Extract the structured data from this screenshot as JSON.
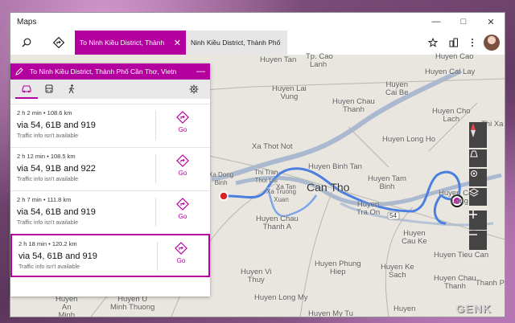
{
  "window": {
    "title": "Maps"
  },
  "tabs": [
    {
      "label": "To Ninh Kiều District, Thành",
      "active": true
    },
    {
      "label": "Ninh Kiều District, Thành Phố Cầr",
      "active": false
    }
  ],
  "panel": {
    "destination": "To Ninh Kiều District, Thành Phố Cần Thơ, Vietn",
    "routes": [
      {
        "summary": "2 h 2 min  •  108.6 km",
        "via": "via 54, 61B and 919",
        "traffic": "Traffic info isn't available",
        "go": "Go"
      },
      {
        "summary": "2 h 12 min  •  108.5 km",
        "via": "via 54, 91B and 922",
        "traffic": "Traffic info isn't available",
        "go": "Go"
      },
      {
        "summary": "2 h 7 min  •  111.8 km",
        "via": "via 54, 61B and 919",
        "traffic": "Traffic info isn't available",
        "go": "Go"
      },
      {
        "summary": "2 h 18 min  •  120.2 km",
        "via": "via 54, 61B and 919",
        "traffic": "Traffic info isn't available",
        "go": "Go"
      }
    ]
  },
  "map_labels": {
    "cao_lanh_top": "Tp. Cao",
    "lanh": "Lanh",
    "huyen_tan_hong_top": "Huyen Tan",
    "huyen_cao_lanh": "Huyen Cao",
    "huyen_cai_lay": "Huyen Cai Lay",
    "huyen_cai_be": "Huyen\nCai Be",
    "huyen_lai_vung": "Huyen Lai\nVung",
    "huyen_chau_thanh_1": "Huyen Chau\nThanh",
    "huyen_cho_lach": "Huyen Cho\nLach",
    "thi_xa_top": "Thi Xa",
    "huyen_long_ho": "Huyen Long Ho",
    "xa_thot_not": "Xa Thot Not",
    "huyen_binh_tan": "Huyen Binh Tan",
    "huyen_tam_binh": "Huyen Tam\nBinh",
    "thi_tran": "Thi Tran\nThoi Lai",
    "xa_dong_binh": "Xa Dong\nBinh",
    "xa_truong": "Xa Truong\nXuan",
    "xa_tan": "Xa Tan",
    "can_tho": "Can Tho",
    "huyen_tra_on": "Huyen\nTra On",
    "huyen_cang_long": "Huyen Cang\nLong",
    "huyen_chau_thanh_a": "Huyen Chau\nThanh A",
    "huyen_cau_ke": "Huyen\nCau Ke",
    "huyen_tieu_can": "Huyen Tieu Can",
    "thanh_pho": "Thanh Pho",
    "huyen_vi_thuy": "Huyen Vi\nThuy",
    "huyen_phung_hiep": "Huyen Phung\nHiep",
    "huyen_ke_sach": "Huyen Ke\nSach",
    "huyen_chau_thanh_b": "Huyen Chau\nThanh",
    "huyen_long_my": "Huyen Long My",
    "huyen_an_minh": "Huyen\nAn\nMinh",
    "huyen_minh_thuong": "Huyen U\nMinh Thuong",
    "huyen_my_tu": "Huyen My Tu",
    "huyen_bottom": "Huyen",
    "road_54": "54",
    "watermark": "GENK"
  },
  "colors": {
    "accent": "#b4009e",
    "route": "#4a7fe0"
  }
}
